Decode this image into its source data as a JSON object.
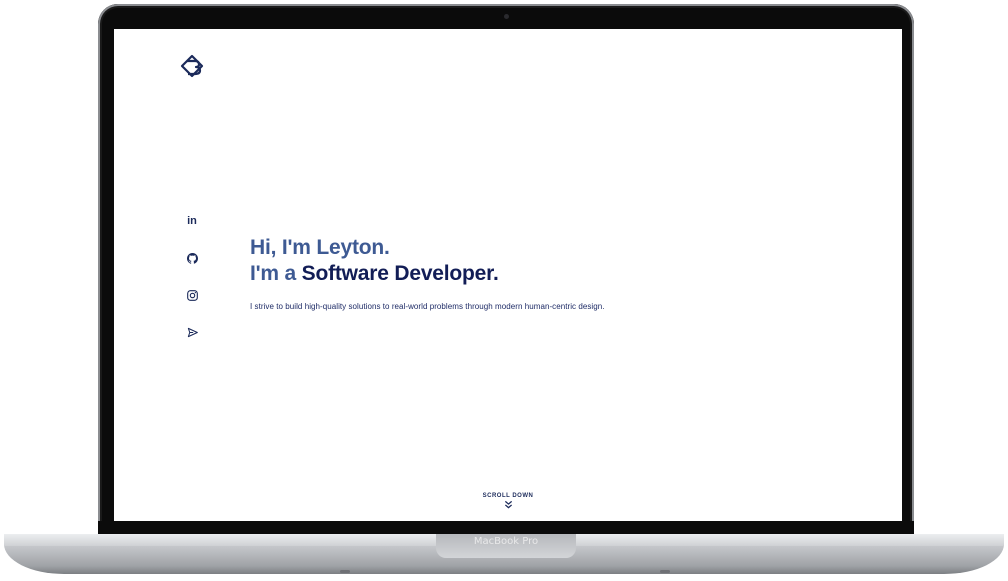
{
  "device": {
    "label": "MacBook Pro"
  },
  "site": {
    "logo_icon": "b-diamond-logo-icon",
    "social_links": [
      {
        "name": "linkedin",
        "icon": "linkedin-icon",
        "text": "in"
      },
      {
        "name": "github",
        "icon": "github-icon"
      },
      {
        "name": "instagram",
        "icon": "instagram-icon"
      },
      {
        "name": "email",
        "icon": "send-icon"
      }
    ],
    "hero": {
      "greeting": "Hi, I'm Leyton.",
      "intro_prefix": "I'm a ",
      "role": "Software Developer",
      "intro_suffix": ".",
      "description": "I strive to build high-quality solutions to real-world problems through modern human-centric design."
    },
    "scroll": {
      "label": "SCROLL DOWN",
      "icon": "double-chevron-down-icon"
    },
    "colors": {
      "accent_dark": "#121d56",
      "accent_light": "#3e5a93",
      "text": "#1e2b66"
    }
  }
}
